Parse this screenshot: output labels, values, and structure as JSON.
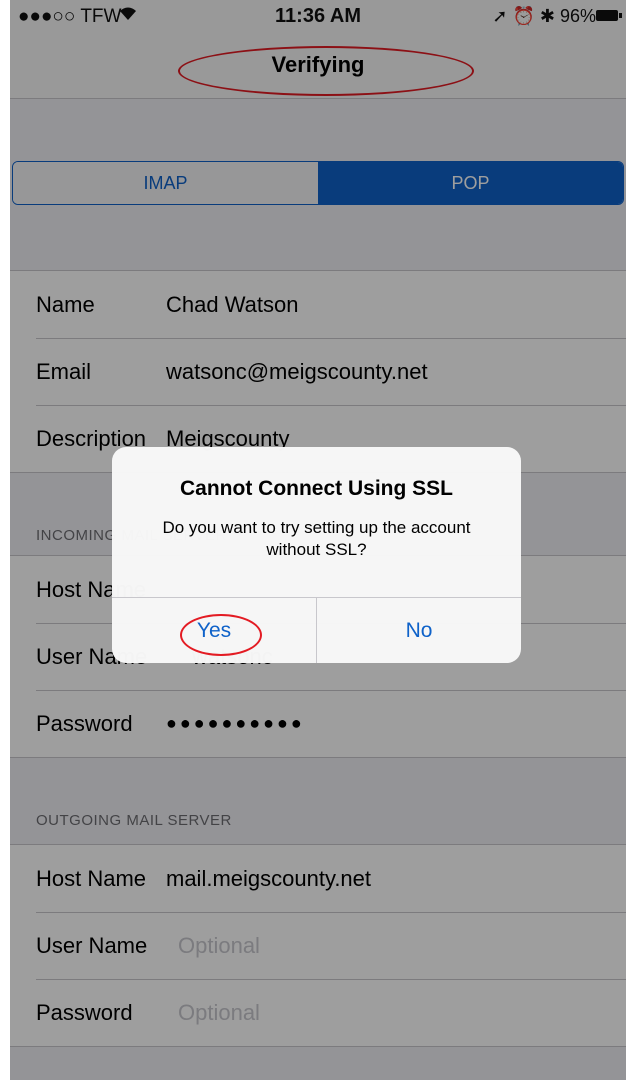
{
  "status_bar": {
    "carrier": "●●●○○ TFW",
    "wifi_icon": "wifi-icon",
    "time": "11:36 AM",
    "right": "➚ ⏰ ✱ 96%"
  },
  "nav": {
    "title": "Verifying"
  },
  "segment": {
    "left": "IMAP",
    "right": "POP",
    "selected": "POP"
  },
  "account": {
    "rows": [
      {
        "label": "Name",
        "value": "Chad Watson"
      },
      {
        "label": "Email",
        "value": "watsonc@meigscounty.net"
      },
      {
        "label": "Description",
        "value": "Meigscounty"
      }
    ]
  },
  "incoming": {
    "header": "INCOMING MAIL SERVER",
    "rows": [
      {
        "label": "Host Name",
        "value": ""
      },
      {
        "label": "User Name",
        "value": "watsonc"
      },
      {
        "label": "Password",
        "value": "●●●●●●●●●●"
      }
    ]
  },
  "outgoing": {
    "header": "OUTGOING MAIL SERVER",
    "rows": [
      {
        "label": "Host Name",
        "value": "mail.meigscounty.net"
      },
      {
        "label": "User Name",
        "placeholder": "Optional"
      },
      {
        "label": "Password",
        "placeholder": "Optional"
      }
    ]
  },
  "alert": {
    "title": "Cannot Connect Using SSL",
    "message": "Do you want to try setting up the account without SSL?",
    "yes": "Yes",
    "no": "No"
  },
  "colors": {
    "accent": "#0f62c9",
    "annotation": "#e31b23",
    "background": "#efeff4"
  }
}
